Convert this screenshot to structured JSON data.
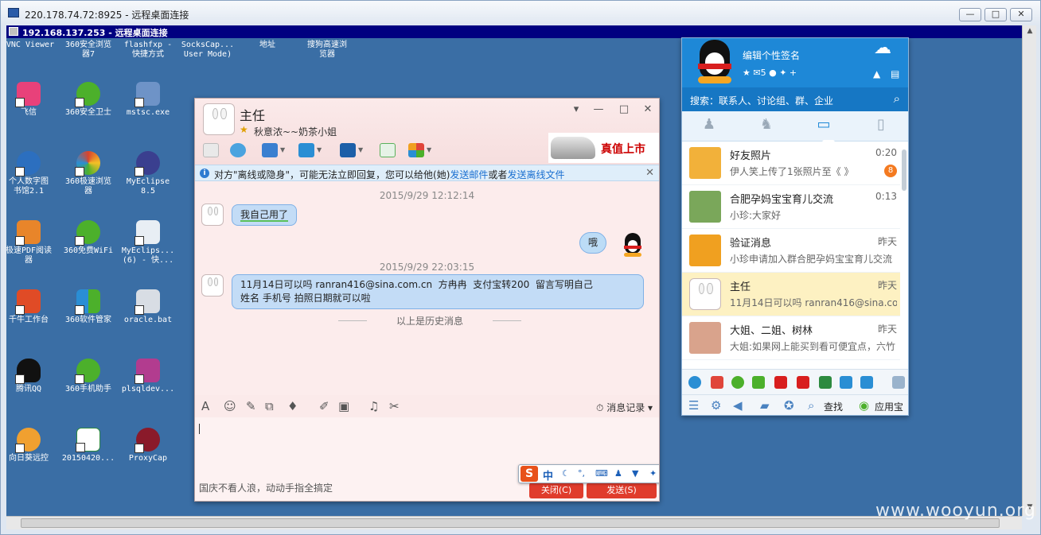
{
  "outer_window": {
    "title": "220.178.74.72:8925 - 远程桌面连接",
    "buttons": [
      "—",
      "□",
      "✕"
    ]
  },
  "inner_window": {
    "title": "192.168.137.253 - 远程桌面连接"
  },
  "desktop": {
    "top_labels": [
      "VNC Viewer",
      "360安全浏览\n器7",
      "flashfxp -\n快捷方式",
      "SocksCap...\nUser Mode)",
      "地址",
      "搜狗高速浏\n览器"
    ],
    "icons": [
      {
        "label": "飞信",
        "color": "#e8417a"
      },
      {
        "label": "360安全卫士",
        "color": "#4cb02b"
      },
      {
        "label": "mstsc.exe",
        "color": "#6e93c7"
      },
      {
        "label": "个人数字图\n书馆2.1",
        "color": "#2c6fbf"
      },
      {
        "label": "360极速浏览\n器",
        "color": "#d9442d"
      },
      {
        "label": "MyEclipse\n8.5",
        "color": "#3a3f8f"
      },
      {
        "label": "极速PDF阅读\n器",
        "color": "#e8852a"
      },
      {
        "label": "360免费WiFi",
        "color": "#4cb02b"
      },
      {
        "label": "MyEclips...\n(6) - 快...",
        "color": "#3a3f8f"
      },
      {
        "label": "千牛工作台",
        "color": "#e04b26"
      },
      {
        "label": "360软件管家",
        "color": "#2a8ed4"
      },
      {
        "label": "oracle.bat",
        "color": "#d8dde4"
      },
      {
        "label": "腾讯QQ",
        "color": "#111111"
      },
      {
        "label": "360手机助手",
        "color": "#4cb02b"
      },
      {
        "label": "plsqldev...",
        "color": "#b23c8f"
      },
      {
        "label": "向日葵远控",
        "color": "#f0a030"
      },
      {
        "label": "20150420...",
        "color": "#2d8a3f"
      },
      {
        "label": "ProxyCap",
        "color": "#8a1a2a"
      }
    ]
  },
  "chat": {
    "name": "主任",
    "signature": "秋意浓~~奶茶小姐",
    "ad_text": "真值上市",
    "notice": {
      "prefix": "对方\"离线或隐身\"，可能无法立即回复，您可以给他(她)",
      "link1": "发送邮件",
      "mid": "或者",
      "link2": "发送离线文件"
    },
    "messages": [
      {
        "time": "2015/9/29 12:12:14",
        "text": "我自己用了"
      },
      {
        "self": true,
        "text": "哦"
      },
      {
        "time": "2015/9/29 22:03:15",
        "text_line1": "11月14日可以吗 ranran416@sina.com.cn  方冉冉  支付宝转200  留言写明自己",
        "text_line2": "姓名 手机号 拍照日期就可以啦"
      }
    ],
    "history_label": "以上是历史消息",
    "record_label": "消息记录",
    "input_hint": "国庆不看人浪，动动手指全搞定",
    "ime": {
      "logo": "S",
      "mode": "中"
    },
    "close_button": "关闭(C)",
    "send_button": "发送(S)"
  },
  "qq_panel": {
    "signature_placeholder": "编辑个性签名",
    "mail_count": "5",
    "search_placeholder": "搜索：联系人、讨论组、群、企业",
    "conversations": [
      {
        "name": "好友照片",
        "time": "0:20",
        "preview": "伊人笑上传了1张照片至《    》",
        "badge": "8",
        "avatar_color": "#f2b13a"
      },
      {
        "name": "合肥孕妈宝宝育儿交流",
        "time": "0:13",
        "preview": "小珍:大家好",
        "avatar_color": "#7aa75a"
      },
      {
        "name": "验证消息",
        "time": "昨天",
        "preview": "小珍申请加入群合肥孕妈宝宝育儿交流",
        "avatar_color": "#f0a020"
      },
      {
        "name": "主任",
        "time": "昨天",
        "preview": "11月14日可以吗 ranran416@sina.com.cn",
        "avatar_color": "#ffffff",
        "selected": true
      },
      {
        "name": "大姐、二姐、树林",
        "time": "昨天",
        "preview": "大姐:如果网上能买到看可便宜点，六竹",
        "avatar_color": "#d9a38c"
      }
    ],
    "find_label": "查找",
    "app_store_label": "应用宝",
    "colors": {
      "header": "#1e88d7",
      "search_bar": "#1677c4"
    }
  },
  "watermark": "www.wooyun.org"
}
